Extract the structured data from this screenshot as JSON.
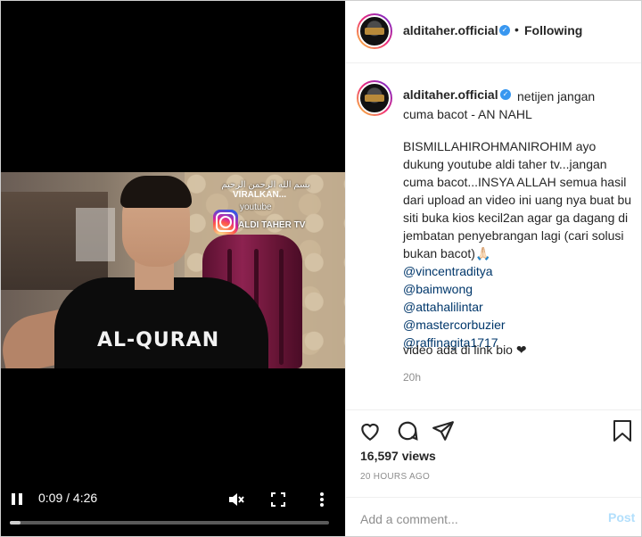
{
  "video": {
    "overlay_arabic": "بسم الله الرحمن الرحيم",
    "overlay_viral": "VIRALKAN...",
    "overlay_youtube": "youtube",
    "overlay_channel": "ALDI TAHER TV",
    "shirt_text": "AL-QURAN",
    "time": "0:09 / 4:26",
    "progress_fraction": 0.034
  },
  "header": {
    "username": "alditaher.official",
    "separator": "•",
    "follow_status": "Following"
  },
  "caption": {
    "username": "alditaher.official",
    "title": "netijen jangan cuma bacot - AN NAHL",
    "body": "BISMILLAHIROHMANIROHIM ayo dukung youtube aldi taher tv...jangan cuma bacot...INSYA ALLAH semua hasil dari upload an video ini uang nya buat bu siti buka kios kecil2an agar ga dagang di jembatan penyebrangan lagi (cari solusi bukan bacot)🙏🏻",
    "mentions": [
      "@vincentraditya",
      "@baimwong",
      "@attahalilintar",
      "@mastercorbuzier",
      "@raffinagita1717"
    ],
    "note": "video ada di link bio ❤",
    "time_ago": "20h"
  },
  "stats": {
    "views": "16,597 views",
    "posted": "20 HOURS AGO"
  },
  "comment": {
    "placeholder": "Add a comment...",
    "post_label": "Post"
  },
  "colors": {
    "link": "#00376b",
    "verified": "#3897f0",
    "post_disabled": "#b2dffc",
    "muted": "#8e8e8e"
  }
}
